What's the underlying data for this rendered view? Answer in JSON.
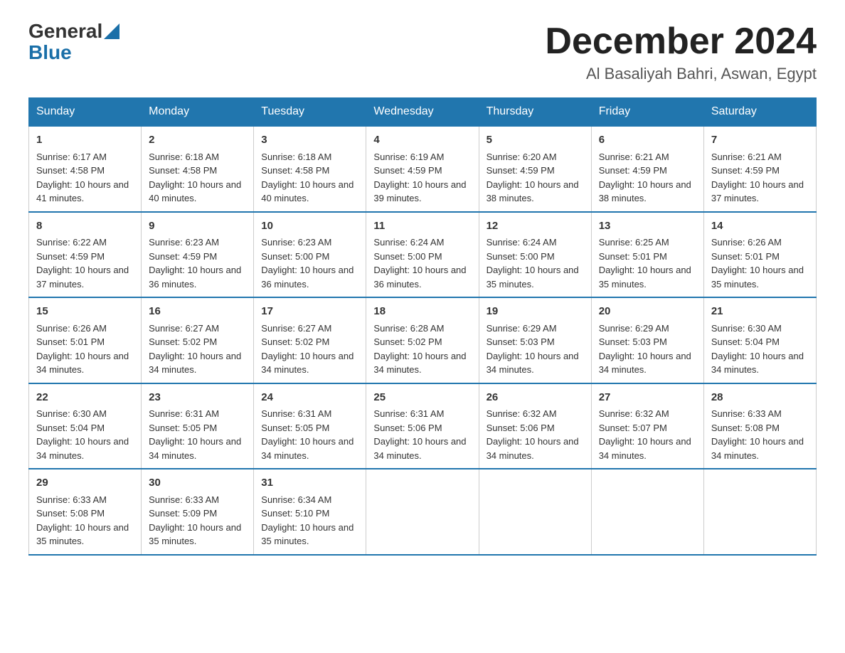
{
  "header": {
    "logo_general": "General",
    "logo_blue": "Blue",
    "month_title": "December 2024",
    "location": "Al Basaliyah Bahri, Aswan, Egypt"
  },
  "days_of_week": [
    "Sunday",
    "Monday",
    "Tuesday",
    "Wednesday",
    "Thursday",
    "Friday",
    "Saturday"
  ],
  "weeks": [
    [
      {
        "day": "1",
        "sunrise": "6:17 AM",
        "sunset": "4:58 PM",
        "daylight": "10 hours and 41 minutes."
      },
      {
        "day": "2",
        "sunrise": "6:18 AM",
        "sunset": "4:58 PM",
        "daylight": "10 hours and 40 minutes."
      },
      {
        "day": "3",
        "sunrise": "6:18 AM",
        "sunset": "4:58 PM",
        "daylight": "10 hours and 40 minutes."
      },
      {
        "day": "4",
        "sunrise": "6:19 AM",
        "sunset": "4:59 PM",
        "daylight": "10 hours and 39 minutes."
      },
      {
        "day": "5",
        "sunrise": "6:20 AM",
        "sunset": "4:59 PM",
        "daylight": "10 hours and 38 minutes."
      },
      {
        "day": "6",
        "sunrise": "6:21 AM",
        "sunset": "4:59 PM",
        "daylight": "10 hours and 38 minutes."
      },
      {
        "day": "7",
        "sunrise": "6:21 AM",
        "sunset": "4:59 PM",
        "daylight": "10 hours and 37 minutes."
      }
    ],
    [
      {
        "day": "8",
        "sunrise": "6:22 AM",
        "sunset": "4:59 PM",
        "daylight": "10 hours and 37 minutes."
      },
      {
        "day": "9",
        "sunrise": "6:23 AM",
        "sunset": "4:59 PM",
        "daylight": "10 hours and 36 minutes."
      },
      {
        "day": "10",
        "sunrise": "6:23 AM",
        "sunset": "5:00 PM",
        "daylight": "10 hours and 36 minutes."
      },
      {
        "day": "11",
        "sunrise": "6:24 AM",
        "sunset": "5:00 PM",
        "daylight": "10 hours and 36 minutes."
      },
      {
        "day": "12",
        "sunrise": "6:24 AM",
        "sunset": "5:00 PM",
        "daylight": "10 hours and 35 minutes."
      },
      {
        "day": "13",
        "sunrise": "6:25 AM",
        "sunset": "5:01 PM",
        "daylight": "10 hours and 35 minutes."
      },
      {
        "day": "14",
        "sunrise": "6:26 AM",
        "sunset": "5:01 PM",
        "daylight": "10 hours and 35 minutes."
      }
    ],
    [
      {
        "day": "15",
        "sunrise": "6:26 AM",
        "sunset": "5:01 PM",
        "daylight": "10 hours and 34 minutes."
      },
      {
        "day": "16",
        "sunrise": "6:27 AM",
        "sunset": "5:02 PM",
        "daylight": "10 hours and 34 minutes."
      },
      {
        "day": "17",
        "sunrise": "6:27 AM",
        "sunset": "5:02 PM",
        "daylight": "10 hours and 34 minutes."
      },
      {
        "day": "18",
        "sunrise": "6:28 AM",
        "sunset": "5:02 PM",
        "daylight": "10 hours and 34 minutes."
      },
      {
        "day": "19",
        "sunrise": "6:29 AM",
        "sunset": "5:03 PM",
        "daylight": "10 hours and 34 minutes."
      },
      {
        "day": "20",
        "sunrise": "6:29 AM",
        "sunset": "5:03 PM",
        "daylight": "10 hours and 34 minutes."
      },
      {
        "day": "21",
        "sunrise": "6:30 AM",
        "sunset": "5:04 PM",
        "daylight": "10 hours and 34 minutes."
      }
    ],
    [
      {
        "day": "22",
        "sunrise": "6:30 AM",
        "sunset": "5:04 PM",
        "daylight": "10 hours and 34 minutes."
      },
      {
        "day": "23",
        "sunrise": "6:31 AM",
        "sunset": "5:05 PM",
        "daylight": "10 hours and 34 minutes."
      },
      {
        "day": "24",
        "sunrise": "6:31 AM",
        "sunset": "5:05 PM",
        "daylight": "10 hours and 34 minutes."
      },
      {
        "day": "25",
        "sunrise": "6:31 AM",
        "sunset": "5:06 PM",
        "daylight": "10 hours and 34 minutes."
      },
      {
        "day": "26",
        "sunrise": "6:32 AM",
        "sunset": "5:06 PM",
        "daylight": "10 hours and 34 minutes."
      },
      {
        "day": "27",
        "sunrise": "6:32 AM",
        "sunset": "5:07 PM",
        "daylight": "10 hours and 34 minutes."
      },
      {
        "day": "28",
        "sunrise": "6:33 AM",
        "sunset": "5:08 PM",
        "daylight": "10 hours and 34 minutes."
      }
    ],
    [
      {
        "day": "29",
        "sunrise": "6:33 AM",
        "sunset": "5:08 PM",
        "daylight": "10 hours and 35 minutes."
      },
      {
        "day": "30",
        "sunrise": "6:33 AM",
        "sunset": "5:09 PM",
        "daylight": "10 hours and 35 minutes."
      },
      {
        "day": "31",
        "sunrise": "6:34 AM",
        "sunset": "5:10 PM",
        "daylight": "10 hours and 35 minutes."
      },
      {
        "day": "",
        "sunrise": "",
        "sunset": "",
        "daylight": ""
      },
      {
        "day": "",
        "sunrise": "",
        "sunset": "",
        "daylight": ""
      },
      {
        "day": "",
        "sunrise": "",
        "sunset": "",
        "daylight": ""
      },
      {
        "day": "",
        "sunrise": "",
        "sunset": "",
        "daylight": ""
      }
    ]
  ]
}
